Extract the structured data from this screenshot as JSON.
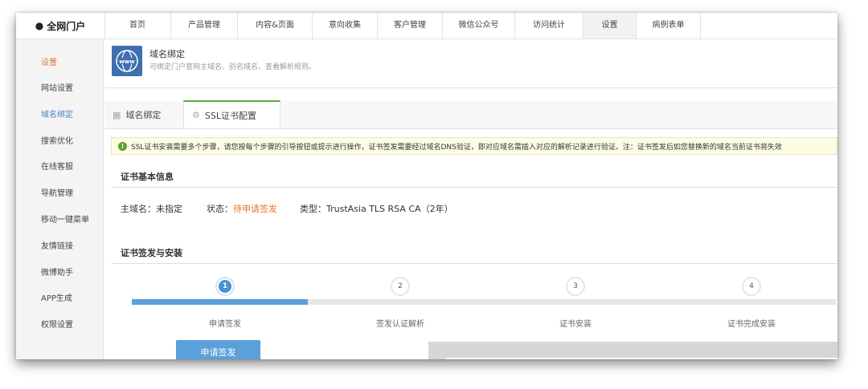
{
  "brand": {
    "name": "全网门户"
  },
  "nav": [
    {
      "label": "首页"
    },
    {
      "label": "产品管理"
    },
    {
      "label": "内容&页面"
    },
    {
      "label": "意向收集"
    },
    {
      "label": "客户管理"
    },
    {
      "label": "微信公众号"
    },
    {
      "label": "访问统计"
    },
    {
      "label": "设置"
    },
    {
      "label": "病例表单"
    }
  ],
  "sidebar": {
    "items": [
      {
        "label": "设置"
      },
      {
        "label": "网站设置"
      },
      {
        "label": "域名绑定"
      },
      {
        "label": "搜索优化"
      },
      {
        "label": "在线客服"
      },
      {
        "label": "导航管理"
      },
      {
        "label": "移动一键菜单"
      },
      {
        "label": "友情链接"
      },
      {
        "label": "微博助手"
      },
      {
        "label": "APP生成"
      },
      {
        "label": "权限设置"
      }
    ]
  },
  "header": {
    "title": "域名绑定",
    "desc": "可绑定门户官网主域名、别名域名、查看解析规则。",
    "icon_text": "www"
  },
  "tabs": [
    {
      "label": "域名绑定"
    },
    {
      "label": "SSL证书配置"
    }
  ],
  "notice": "SSL证书安装需要多个步骤，请您按每个步骤的引导按钮或提示进行操作，证书签发需要经过域名DNS验证，即对应域名需插入对应的解析记录进行验证。注：证书签发后如您替换新的域名当前证书将失效",
  "cert_info": {
    "section_title": "证书基本信息",
    "domain_label": "主域名：",
    "domain_value": "未指定",
    "status_label": "状态：",
    "status_value": "待申请签发",
    "type_label": "类型：",
    "type_value": "TrustAsia TLS RSA CA（2年）"
  },
  "install": {
    "section_title": "证书签发与安装",
    "progress": 0.25,
    "steps": [
      {
        "num": "1",
        "label": "申请签发"
      },
      {
        "num": "2",
        "label": "签发认证解析"
      },
      {
        "num": "3",
        "label": "证书安装"
      },
      {
        "num": "4",
        "label": "证书完成安装"
      }
    ],
    "button_label": "申请签发"
  },
  "colors": {
    "accent_blue": "#5b9fdb",
    "status_orange": "#e9742b",
    "active_tab_green": "#5aaa3c",
    "icon_bg": "#3f6fae"
  }
}
